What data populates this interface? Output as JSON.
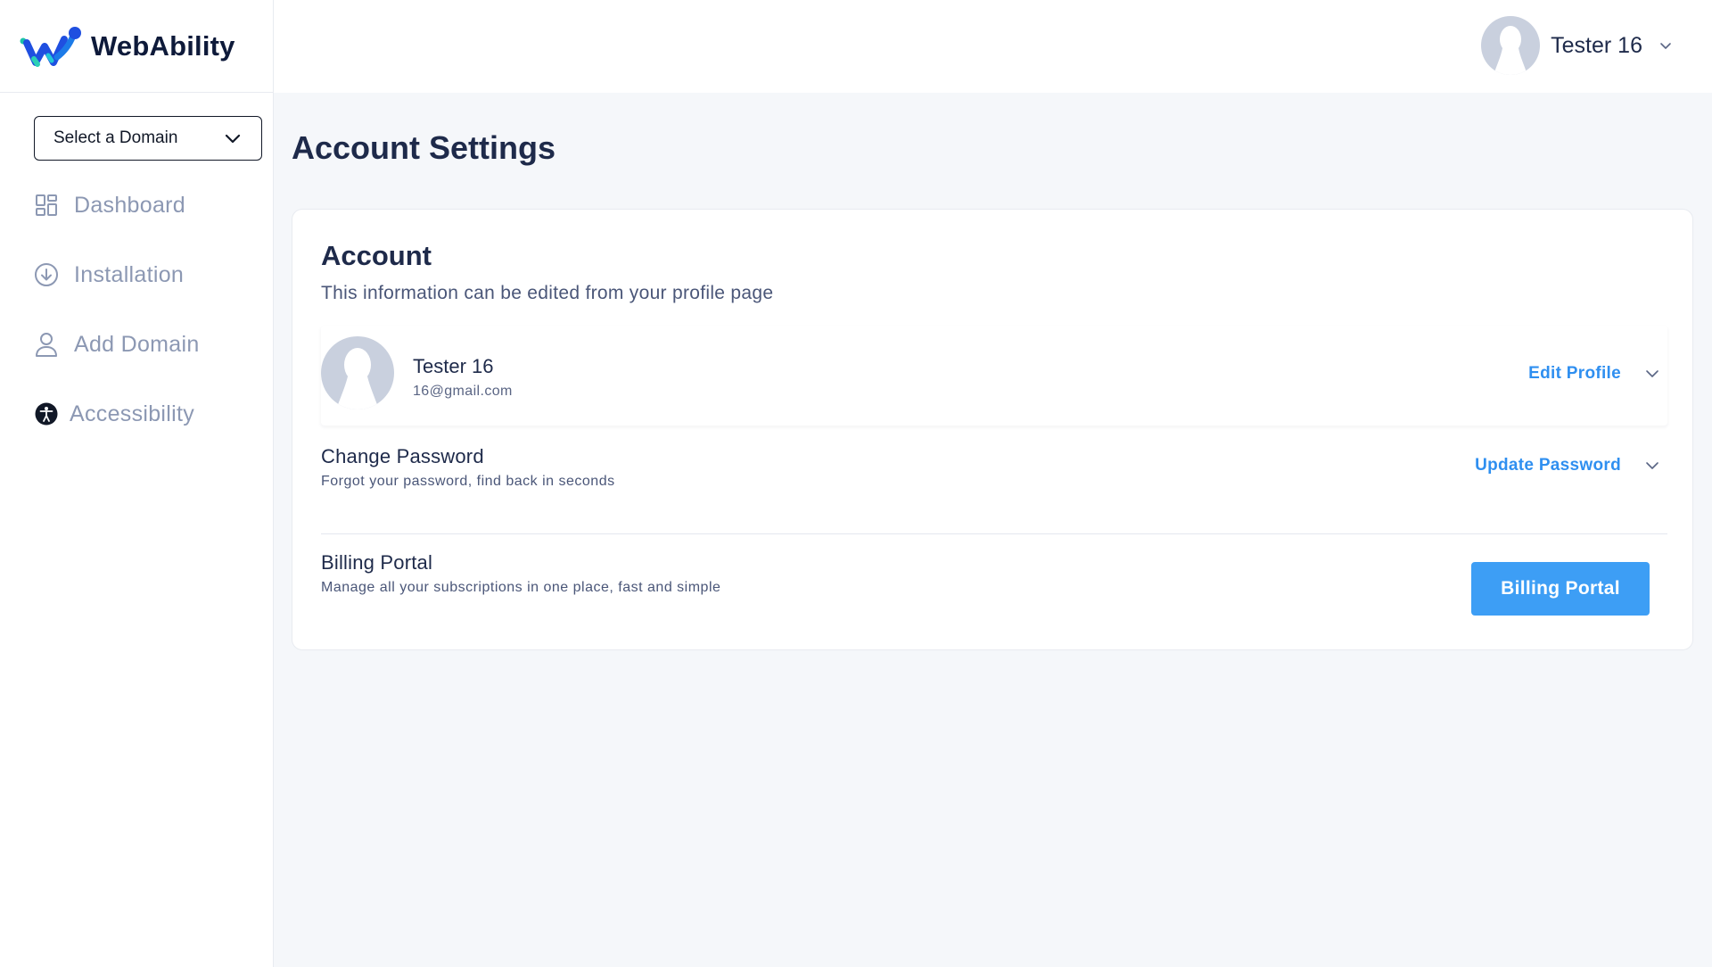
{
  "brand": {
    "name": "WebAbility"
  },
  "sidebar": {
    "domain_select": {
      "label": "Select a Domain"
    },
    "items": [
      {
        "label": "Dashboard",
        "icon": "dashboard-grid-icon"
      },
      {
        "label": "Installation",
        "icon": "download-circle-icon"
      },
      {
        "label": "Add Domain",
        "icon": "user-icon"
      },
      {
        "label": "Accessibility",
        "icon": "accessibility-icon"
      }
    ]
  },
  "header": {
    "user_name": "Tester 16"
  },
  "main": {
    "title": "Account Settings",
    "account": {
      "title": "Account",
      "subtitle": "This information can be edited from your profile page",
      "profile": {
        "name": "Tester 16",
        "email": "16@gmail.com",
        "action": "Edit Profile"
      },
      "password": {
        "title": "Change Password",
        "subtitle": "Forgot your password, find back in seconds",
        "action": "Update Password"
      },
      "billing": {
        "title": "Billing Portal",
        "subtitle": "Manage all your subscriptions in one place, fast and simple",
        "action": "Billing Portal"
      }
    }
  },
  "colors": {
    "accent": "#2f8ff0",
    "button": "#3d9ef5",
    "heading": "#1e2a4a",
    "muted": "#8c98b3"
  }
}
